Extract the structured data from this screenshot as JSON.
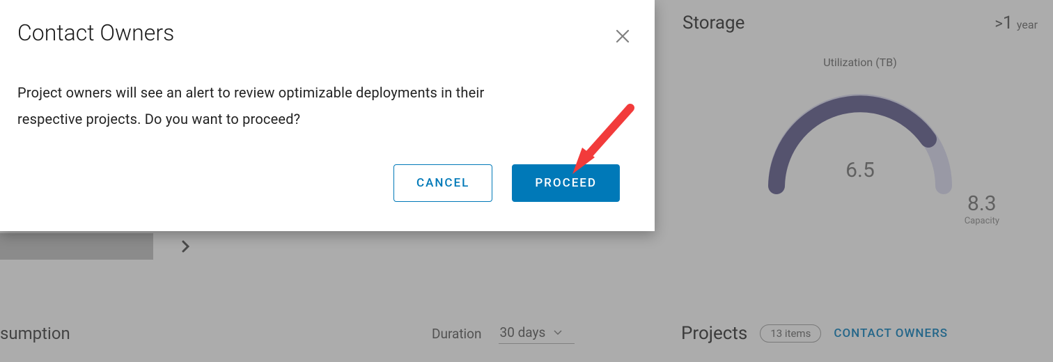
{
  "modal": {
    "title": "Contact Owners",
    "body": "Project owners will see an alert to review optimizable deployments in their respective projects. Do you want to proceed?",
    "cancel_label": "CANCEL",
    "proceed_label": "PROCEED"
  },
  "storage": {
    "title": "Storage",
    "duration_prefix": ">",
    "duration_value": "1",
    "duration_unit": "year",
    "util_label": "Utilization (TB)",
    "value": "6.5",
    "capacity_value": "8.3",
    "capacity_label": "Capacity"
  },
  "bottom": {
    "sumption": "sumption",
    "duration_label": "Duration",
    "duration_value": "30 days",
    "projects_title": "Projects",
    "items_badge": "13 items",
    "contact_owners": "CONTACT OWNERS"
  },
  "chart_data": {
    "type": "gauge",
    "title": "Utilization (TB)",
    "value": 6.5,
    "max": 8.3,
    "max_label": "Capacity",
    "colors": {
      "fill": "#5a5687",
      "track": "#d6d6ec"
    }
  }
}
